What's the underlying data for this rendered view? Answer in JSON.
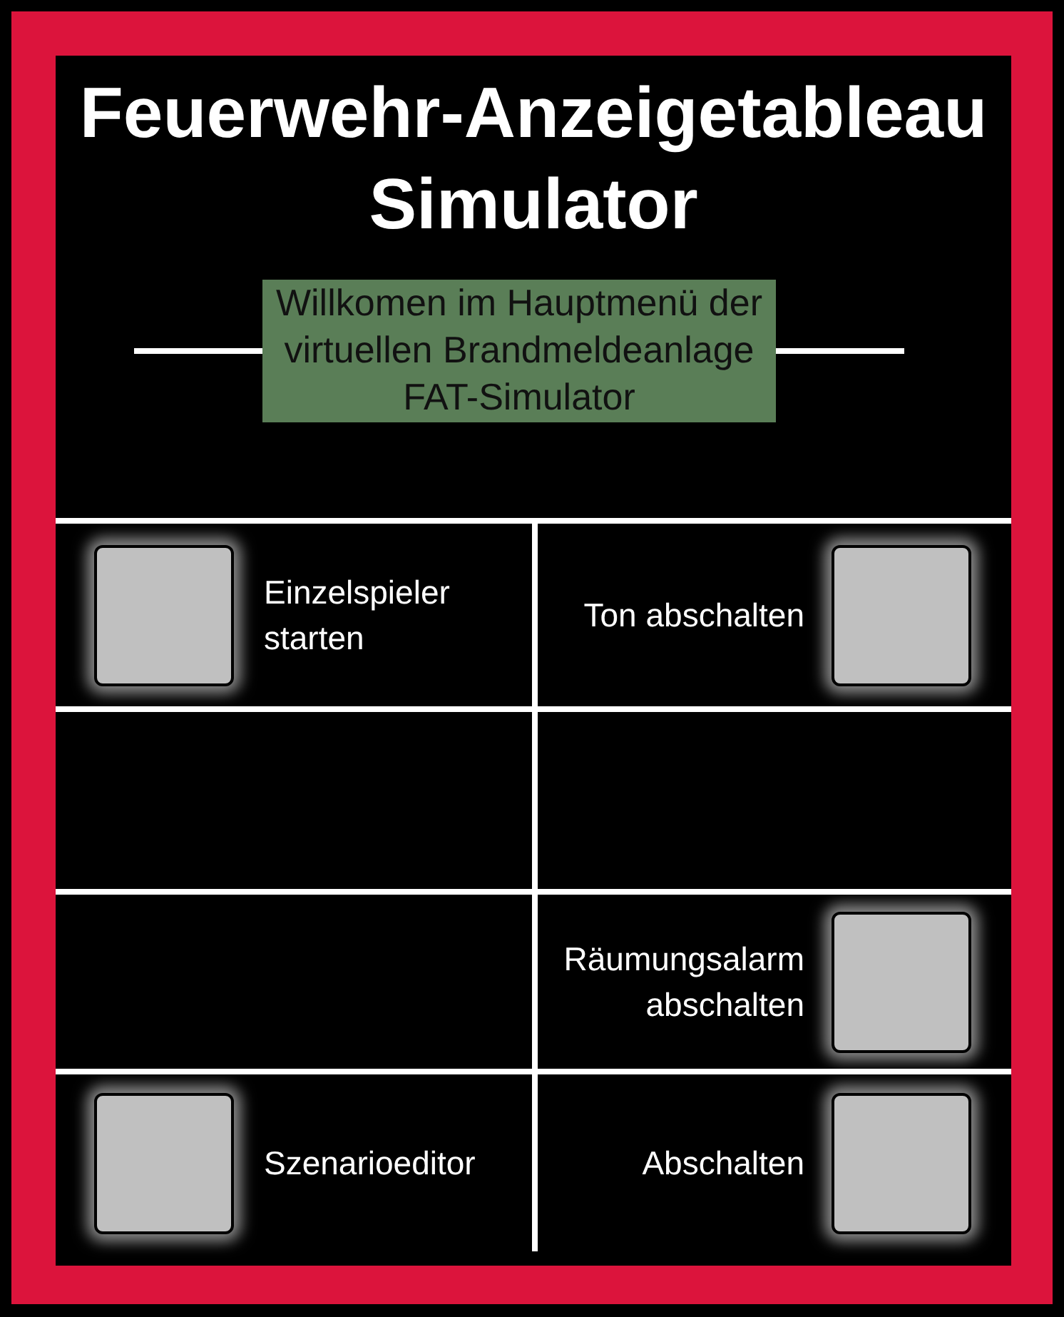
{
  "title": "Feuerwehr-Anzeigetableau Simulator",
  "welcome": "Willkomen im Hauptmenü der virtuellen Brandmeldeanlage FAT-Simulator",
  "rows": [
    {
      "cells": [
        {
          "kind": "button-left",
          "label": "Einzelspieler starten"
        },
        {
          "kind": "button-right",
          "label": "Ton abschalten"
        }
      ]
    },
    {
      "cells": [
        {
          "kind": "empty"
        },
        {
          "kind": "empty"
        }
      ]
    },
    {
      "cells": [
        {
          "kind": "empty"
        },
        {
          "kind": "button-right",
          "label": "Räumungsalarm abschalten"
        }
      ]
    },
    {
      "cells": [
        {
          "kind": "button-left",
          "label": "Szenarioeditor"
        },
        {
          "kind": "button-right",
          "label": "Abschalten"
        }
      ]
    }
  ]
}
